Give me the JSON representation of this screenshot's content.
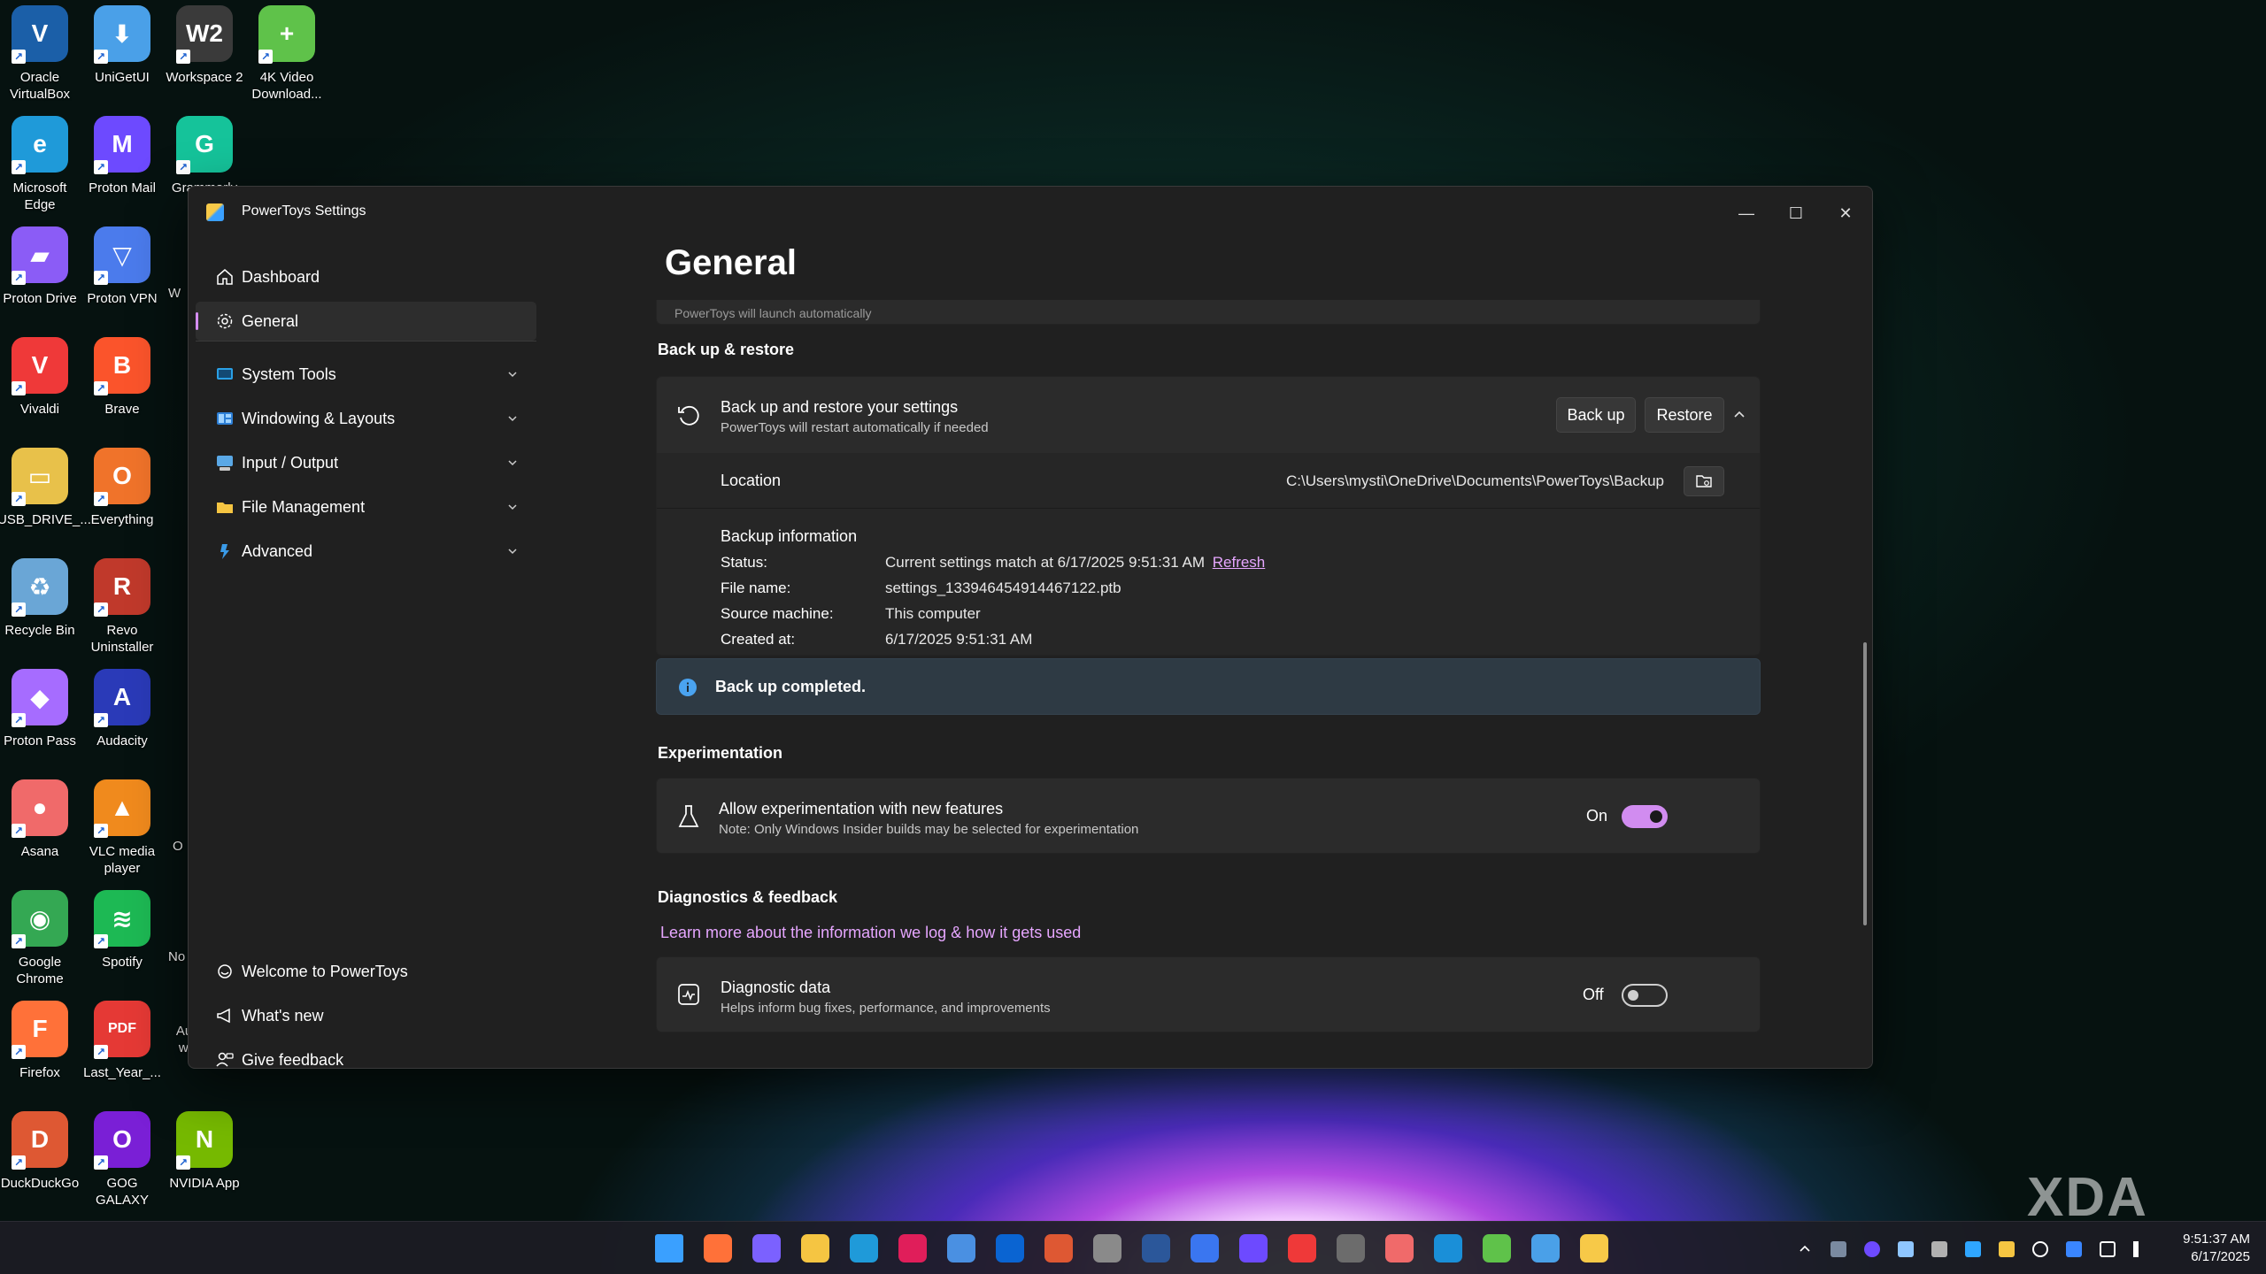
{
  "desktop": {
    "icons": [
      {
        "label": "Oracle VirtualBox",
        "glyph": "V",
        "color": "#1b5fa8"
      },
      {
        "label": "UniGetUI",
        "glyph": "⬇",
        "color": "#4aa0e8"
      },
      {
        "label": "Workspace 2",
        "glyph": "W2",
        "color": "#3a3a3a"
      },
      {
        "label": "4K Video Download...",
        "glyph": "+",
        "color": "#5fc24a"
      },
      {
        "label": "Microsoft Edge",
        "glyph": "e",
        "color": "#1f9ad9"
      },
      {
        "label": "Proton Mail",
        "glyph": "M",
        "color": "#6d4aff"
      },
      {
        "label": "Grammarly",
        "glyph": "G",
        "color": "#15c39a"
      },
      {
        "label": "Proton Drive",
        "glyph": "▰",
        "color": "#8b5cf6"
      },
      {
        "label": "Proton VPN",
        "glyph": "▽",
        "color": "#4b7bec"
      },
      {
        "label": "Vivaldi",
        "glyph": "V",
        "color": "#ef3939"
      },
      {
        "label": "Brave",
        "glyph": "B",
        "color": "#fb542b"
      },
      {
        "label": "USB_DRIVE_...",
        "glyph": "▭",
        "color": "#e8c14a"
      },
      {
        "label": "Everything",
        "glyph": "O",
        "color": "#f0732a"
      },
      {
        "label": "Recycle Bin",
        "glyph": "♻",
        "color": "#6aa6d6"
      },
      {
        "label": "Revo Uninstaller",
        "glyph": "R",
        "color": "#c0392b"
      },
      {
        "label": "Proton Pass",
        "glyph": "◆",
        "color": "#a66cff"
      },
      {
        "label": "Audacity",
        "glyph": "A",
        "color": "#2a3ab8"
      },
      {
        "label": "Asana",
        "glyph": "●",
        "color": "#f06a6a"
      },
      {
        "label": "VLC media player",
        "glyph": "▲",
        "color": "#f08a1d"
      },
      {
        "label": "Google Chrome",
        "glyph": "◉",
        "color": "#34a853"
      },
      {
        "label": "Spotify",
        "glyph": "≋",
        "color": "#1db954"
      },
      {
        "label": "Firefox",
        "glyph": "F",
        "color": "#ff7139"
      },
      {
        "label": "Last_Year_...",
        "glyph": "PDF",
        "color": "#e53935"
      },
      {
        "label": "DuckDuckGo",
        "glyph": "D",
        "color": "#de5833"
      },
      {
        "label": "GOG GALAXY",
        "glyph": "O",
        "color": "#7a1fd6"
      },
      {
        "label": "NVIDIA App",
        "glyph": "N",
        "color": "#76b900"
      }
    ],
    "partial_labels": [
      "W",
      "O",
      "No",
      "Automate workflow"
    ]
  },
  "window": {
    "title": "PowerToys Settings",
    "controls": {
      "minimize": "—",
      "maximize": "☐",
      "close": "✕"
    }
  },
  "nav": {
    "items": [
      {
        "label": "Dashboard",
        "icon": "home-icon"
      },
      {
        "label": "General",
        "icon": "gear-icon"
      },
      {
        "label": "System Tools",
        "icon": "system-tools-icon",
        "expandable": true
      },
      {
        "label": "Windowing & Layouts",
        "icon": "windowing-icon",
        "expandable": true
      },
      {
        "label": "Input / Output",
        "icon": "input-output-icon",
        "expandable": true
      },
      {
        "label": "File Management",
        "icon": "folder-icon",
        "expandable": true
      },
      {
        "label": "Advanced",
        "icon": "advanced-icon",
        "expandable": true
      }
    ],
    "footer": [
      {
        "label": "Welcome to PowerToys",
        "icon": "welcome-icon"
      },
      {
        "label": "What's new",
        "icon": "megaphone-icon"
      },
      {
        "label": "Give feedback",
        "icon": "feedback-icon"
      }
    ]
  },
  "page": {
    "title": "General",
    "cut_off_text": "PowerToys will launch automatically"
  },
  "backup": {
    "section_title": "Back up & restore",
    "card_title": "Back up and restore your settings",
    "card_subtitle": "PowerToys will restart automatically if needed",
    "backup_button": "Back up",
    "restore_button": "Restore",
    "location_label": "Location",
    "location_value": "C:\\Users\\mysti\\OneDrive\\Documents\\PowerToys\\Backup",
    "info_title": "Backup information",
    "status_label": "Status:",
    "status_value": "Current settings match at 6/17/2025 9:51:31 AM",
    "refresh_link": "Refresh",
    "filename_label": "File name:",
    "filename_value": "settings_133946454914467122.ptb",
    "source_label": "Source machine:",
    "source_value": "This computer",
    "created_label": "Created at:",
    "created_value": "6/17/2025 9:51:31 AM",
    "infobar": "Back up completed."
  },
  "experimentation": {
    "section_title": "Experimentation",
    "title": "Allow experimentation with new features",
    "subtitle": "Note: Only Windows Insider builds may be selected for experimentation",
    "state_label": "On",
    "enabled": true
  },
  "diagnostics": {
    "section_title": "Diagnostics & feedback",
    "link": "Learn more about the information we log & how it gets used",
    "title": "Diagnostic data",
    "subtitle": "Helps inform bug fixes, performance, and improvements",
    "state_label": "Off",
    "enabled": false
  },
  "taskbar": {
    "apps": [
      "start-icon",
      "firefox-icon",
      "copilot-icon",
      "file-explorer-icon",
      "edge-icon",
      "slack-icon",
      "store-icon",
      "outlook-icon",
      "duckduckgo-icon",
      "settings-icon",
      "word-icon",
      "signal-icon",
      "proton-mail-icon",
      "vivaldi-icon",
      "calculator-icon",
      "asana-icon",
      "sway-icon",
      "4k-downloader-icon",
      "notepad-icon",
      "powertoys-icon"
    ],
    "time": "9:51:37 AM",
    "date": "6/17/2025"
  },
  "watermark": "XDA"
}
